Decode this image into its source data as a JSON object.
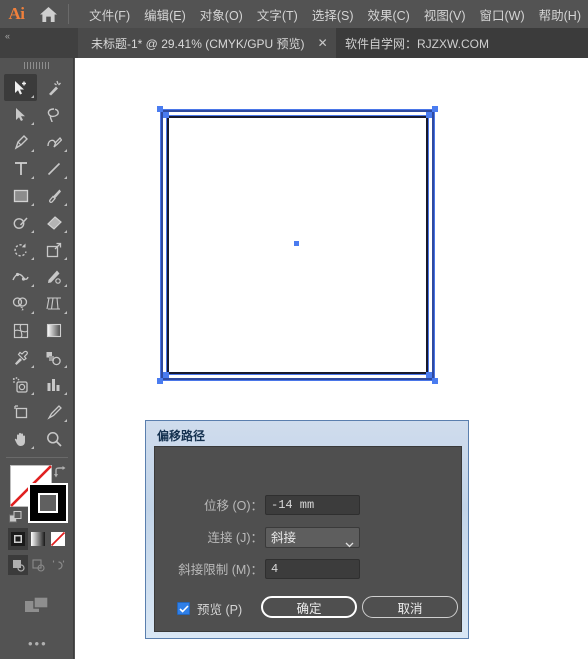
{
  "app": {
    "name": "Ai",
    "logo_color": "#f0803c"
  },
  "menubar": {
    "home_icon": "home-icon",
    "items": [
      {
        "label": "文件(F)"
      },
      {
        "label": "编辑(E)"
      },
      {
        "label": "对象(O)"
      },
      {
        "label": "文字(T)"
      },
      {
        "label": "选择(S)"
      },
      {
        "label": "效果(C)"
      },
      {
        "label": "视图(V)"
      },
      {
        "label": "窗口(W)"
      },
      {
        "label": "帮助(H)"
      }
    ]
  },
  "tabbar": {
    "collapse_icon": "«",
    "document_tab": {
      "label": "未标题-1* @ 29.41% (CMYK/GPU 预览)",
      "close_icon": "✕"
    },
    "promo_text": "软件自学网：RJZXW.COM"
  },
  "toolbar": {
    "tools": [
      {
        "name": "selection-plus-tool",
        "active": true
      },
      {
        "name": "magic-wand-tool",
        "active": false
      },
      {
        "name": "direct-selection-tool",
        "active": false
      },
      {
        "name": "lasso-tool",
        "active": false
      },
      {
        "name": "pen-tool",
        "active": false
      },
      {
        "name": "curvature-tool",
        "active": false
      },
      {
        "name": "type-tool",
        "active": false
      },
      {
        "name": "line-segment-tool",
        "active": false
      },
      {
        "name": "rectangle-tool",
        "active": false
      },
      {
        "name": "paintbrush-tool",
        "active": false
      },
      {
        "name": "shaper-tool",
        "active": false
      },
      {
        "name": "eraser-tool",
        "active": false
      },
      {
        "name": "rotate-tool",
        "active": false
      },
      {
        "name": "scale-tool",
        "active": false
      },
      {
        "name": "width-tool",
        "active": false
      },
      {
        "name": "free-transform-tool",
        "active": false
      },
      {
        "name": "shape-builder-tool",
        "active": false
      },
      {
        "name": "perspective-grid-tool",
        "active": false
      },
      {
        "name": "mesh-tool",
        "active": false
      },
      {
        "name": "gradient-tool",
        "active": false
      },
      {
        "name": "eyedropper-tool",
        "active": false
      },
      {
        "name": "blend-tool",
        "active": false
      },
      {
        "name": "symbol-sprayer-tool",
        "active": false
      },
      {
        "name": "column-graph-tool",
        "active": false
      },
      {
        "name": "artboard-tool",
        "active": false
      },
      {
        "name": "slice-tool",
        "active": false
      },
      {
        "name": "hand-tool",
        "active": false
      },
      {
        "name": "zoom-tool",
        "active": false
      }
    ],
    "colors": {
      "stroke_swatch": "#ffffff",
      "stroke_none_slash": "#e02020",
      "fill_swatch": "#000000"
    },
    "fill_modes": [
      {
        "name": "color-mode",
        "active": true
      },
      {
        "name": "gradient-mode",
        "active": false
      },
      {
        "name": "none-mode",
        "active": false
      }
    ],
    "draw_modes": [
      {
        "name": "draw-normal",
        "active": true
      },
      {
        "name": "draw-behind",
        "active": false
      },
      {
        "name": "draw-inside",
        "active": false
      }
    ],
    "more_icon": "•••"
  },
  "canvas": {
    "background": "#ffffff",
    "artwork": {
      "outer_path_color": "#2f4aa0",
      "inner_path_color": "#16192e",
      "selection_color": "#4a7cf0"
    }
  },
  "dialog": {
    "title": "偏移路径",
    "fields": [
      {
        "name": "offset",
        "label": "位移 (O)：",
        "value": "-14 mm",
        "type": "text"
      },
      {
        "name": "joins",
        "label": "连接 (J)：",
        "value": "斜接",
        "type": "select"
      },
      {
        "name": "miter_limit",
        "label": "斜接限制 (M)：",
        "value": "4",
        "type": "text"
      }
    ],
    "preview": {
      "label": "预览 (P)",
      "checked": true,
      "check_glyph": "✓"
    },
    "buttons": {
      "ok": "确定",
      "cancel": "取消"
    },
    "accent_color": "#2f7fe8"
  }
}
